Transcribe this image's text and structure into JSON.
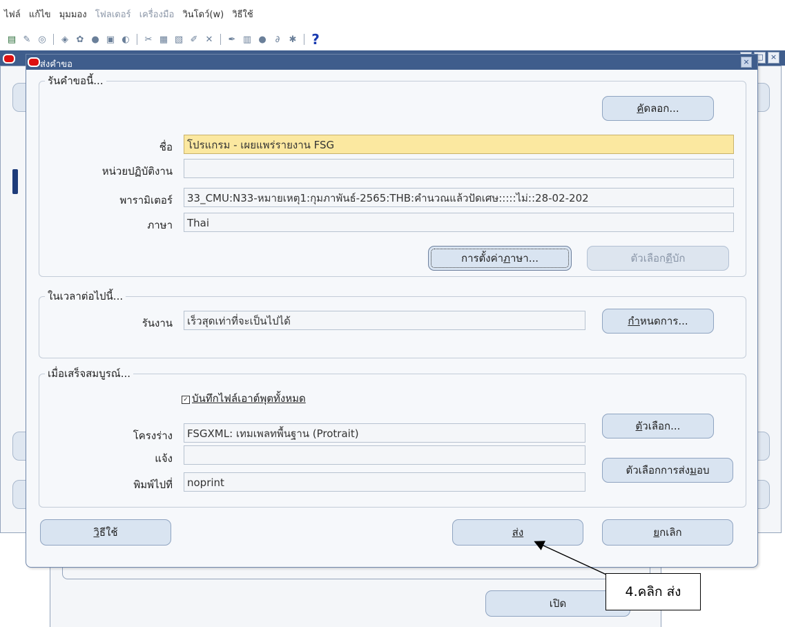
{
  "menubar": {
    "file": "ไฟล์",
    "edit": "แก้ไข",
    "view": "มุมมอง",
    "folder": "โฟลเดอร์",
    "tools": "เครื่องมือ",
    "window": "วินโดว์(w)",
    "help": "วิธีใช้"
  },
  "toolbar": {
    "icons": [
      "new-record-icon",
      "clear-icon",
      "back-icon",
      "open-icon",
      "find-icon",
      "navigator-icon",
      "print-icon",
      "zoom-icon",
      "cut-icon",
      "copy-icon",
      "paste-icon",
      "edit-icon",
      "delete-icon",
      "attach-icon",
      "folder-icon",
      "globe-icon",
      "paperclip-icon",
      "translate-icon",
      "help-icon"
    ],
    "help_glyph": "?"
  },
  "dialog": {
    "title": "ส่งคำขอ",
    "close_glyph": "×",
    "section_request": {
      "legend": "รันคำขอนี้...",
      "copy_button": "คัดลอก...",
      "name_label": "ชื่อ",
      "name_value": "โปรแกรม - เผยแพร่รายงาน FSG",
      "ou_label": "หน่วยปฏิบัติงาน",
      "ou_value": "",
      "params_label": "พารามิเตอร์",
      "params_value": "33_CMU:N33-หมายเหตุ1:กุมภาพันธ์-2565:THB:คำนวณแล้วปัดเศษ:::::ไม่::28-02-202",
      "lang_label": "ภาษา",
      "lang_value": "Thai",
      "lang_settings_button": "การตั้งค่าภาษา...",
      "debug_options_button": "ตัวเลือกดีบัก"
    },
    "section_schedule": {
      "legend": "ในเวลาต่อไปนี้...",
      "run_label": "รันงาน",
      "run_value": "เร็วสุดเท่าที่จะเป็นไปได้",
      "schedule_button": "กำหนดการ..."
    },
    "section_completion": {
      "legend": "เมื่อเสร็จสมบูรณ์...",
      "save_output_label": "บันทึกไฟล์เอาต์พุตทั้งหมด",
      "save_output_checked": true,
      "layout_label": "โครงร่าง",
      "layout_value": "FSGXML: เทมเพลทพื้นฐาน (Protrait)",
      "options_button": "ตัวเลือก...",
      "notify_label": "แจ้ง",
      "notify_value": "",
      "delivery_button": "ตัวเลือกการส่งมอบ",
      "printto_label": "พิมพ์ไปที่",
      "printto_value": "noprint"
    },
    "help_button": "วิธีใช้",
    "submit_button": "ส่ง",
    "cancel_button": "ยกเลิก"
  },
  "background": {
    "open_button": "เปิด",
    "controls": [
      "×",
      "□",
      "×"
    ]
  },
  "annotation": {
    "callout": "4.คลิก ส่ง"
  }
}
